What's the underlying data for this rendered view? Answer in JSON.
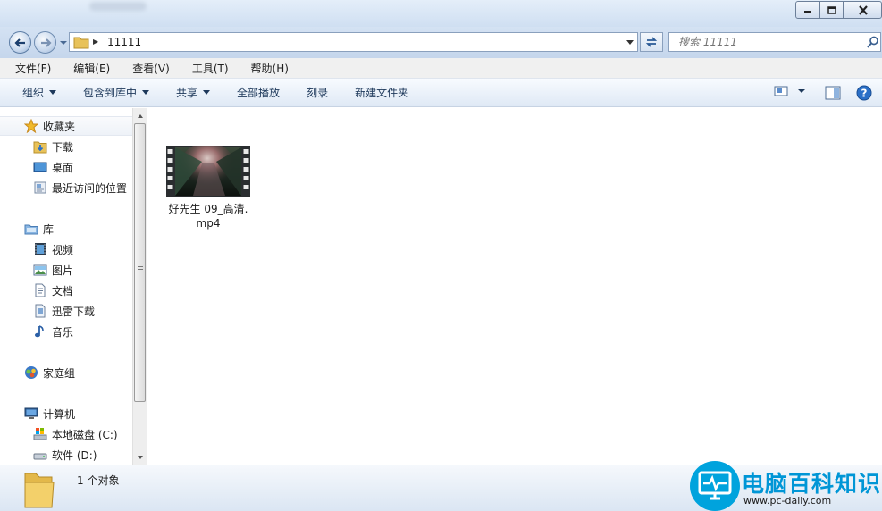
{
  "window": {
    "icons": {
      "minimize": "minimize-icon",
      "maximize": "maximize-icon",
      "close": "close-icon"
    }
  },
  "address": {
    "path": "11111",
    "search_placeholder": "搜索 11111"
  },
  "menubar": {
    "items": [
      "文件(F)",
      "编辑(E)",
      "查看(V)",
      "工具(T)",
      "帮助(H)"
    ]
  },
  "toolbar": {
    "organize": "组织",
    "include_in_library": "包含到库中",
    "share": "共享",
    "play_all": "全部播放",
    "burn": "刻录",
    "new_folder": "新建文件夹"
  },
  "sidebar": {
    "favorites": {
      "label": "收藏夹",
      "items": [
        "下载",
        "桌面",
        "最近访问的位置"
      ]
    },
    "libraries": {
      "label": "库",
      "items": [
        "视频",
        "图片",
        "文档",
        "迅雷下载",
        "音乐"
      ]
    },
    "homegroup": {
      "label": "家庭组"
    },
    "computer": {
      "label": "计算机",
      "items": [
        "本地磁盘 (C:)",
        "软件 (D:)"
      ]
    }
  },
  "files": [
    {
      "name_line1": "好先生 09_高清.",
      "name_line2": "mp4",
      "type": "video"
    }
  ],
  "status": {
    "count": "1 个对象"
  },
  "watermark": {
    "brand": "电脑百科知识",
    "url": "www.pc-daily.com"
  },
  "colors": {
    "accent": "#00a3dd",
    "chrome": "#cfdff2"
  }
}
